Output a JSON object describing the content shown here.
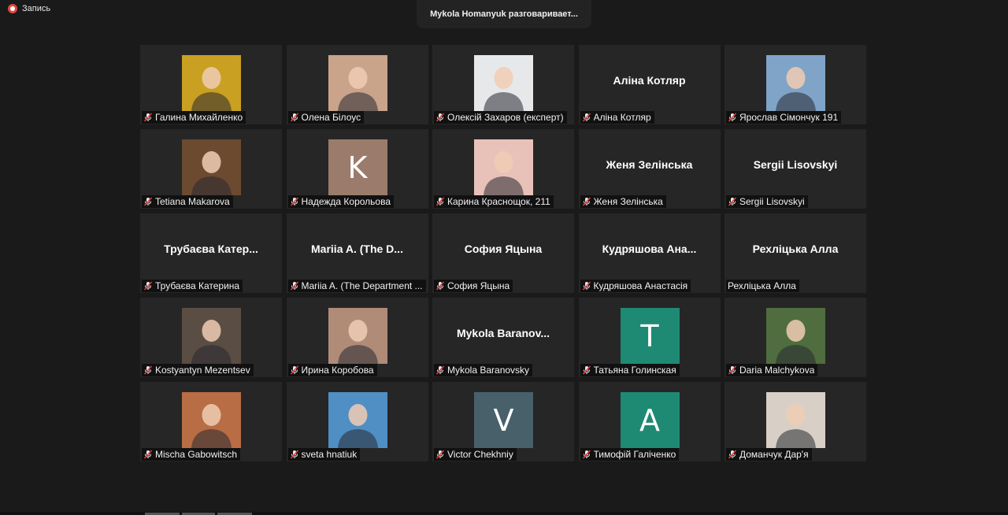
{
  "recording": {
    "label": "Запись"
  },
  "speaker": {
    "text": "Mykola Homanyuk разговаривает..."
  },
  "participants": [
    {
      "name": "Галина Михайленко",
      "muted": true,
      "type": "photo",
      "bg": "#c9a021"
    },
    {
      "name": "Олена Білоус",
      "muted": true,
      "type": "photo",
      "bg": "#c9a48a"
    },
    {
      "name": "Олексій Захаров (експерт)",
      "muted": true,
      "type": "photo",
      "bg": "#e6e8ea"
    },
    {
      "name": "Аліна Котляр",
      "muted": true,
      "type": "name",
      "display": "Аліна Котляр"
    },
    {
      "name": "Ярослав Сімончук 191",
      "muted": true,
      "type": "photo",
      "bg": "#7fa4c8"
    },
    {
      "name": "Tetiana Makarova",
      "muted": true,
      "type": "photo",
      "bg": "#6b4a2f"
    },
    {
      "name": "Надежда Корольова",
      "muted": true,
      "type": "initial",
      "display": "K",
      "bg": "#9b7b6b"
    },
    {
      "name": "Карина Краснощок, 211",
      "muted": true,
      "type": "photo",
      "bg": "#e8c2b8"
    },
    {
      "name": "Женя Зелінська",
      "muted": true,
      "type": "name",
      "display": "Женя Зелінська"
    },
    {
      "name": "Sergii Lisovskyi",
      "muted": true,
      "type": "name",
      "display": "Sergii Lisovskyi"
    },
    {
      "name": "Трубаєва Катерина",
      "muted": true,
      "type": "name",
      "display": "Трубаєва Катер..."
    },
    {
      "name": "Mariia A. (The Department ...",
      "muted": true,
      "type": "name",
      "display": "Mariia A. (The D..."
    },
    {
      "name": "София Яцына",
      "muted": true,
      "type": "name",
      "display": "София Яцына"
    },
    {
      "name": "Кудряшова Анастасія",
      "muted": true,
      "type": "name",
      "display": "Кудряшова  Ана..."
    },
    {
      "name": "Рехліцька Алла",
      "muted": false,
      "type": "name",
      "display": "Рехліцька Алла"
    },
    {
      "name": "Kostyantyn Mezentsev",
      "muted": true,
      "type": "photo",
      "bg": "#5a4d44"
    },
    {
      "name": "Ирина Коробова",
      "muted": true,
      "type": "photo",
      "bg": "#b08c78"
    },
    {
      "name": "Mykola Baranovsky",
      "muted": true,
      "type": "name",
      "display": "Mykola  Baranov..."
    },
    {
      "name": "Татьяна Голинская",
      "muted": true,
      "type": "initial",
      "display": "T",
      "bg": "#1f8a73"
    },
    {
      "name": "Daria Malchykova",
      "muted": true,
      "type": "photo",
      "bg": "#4f6d3f"
    },
    {
      "name": "Mischa Gabowitsch",
      "muted": true,
      "type": "photo",
      "bg": "#b86d44"
    },
    {
      "name": "sveta hnatiuk",
      "muted": true,
      "type": "photo",
      "bg": "#4f8fc4"
    },
    {
      "name": "Victor Chekhniy",
      "muted": true,
      "type": "initial",
      "display": "V",
      "bg": "#48606a"
    },
    {
      "name": "Тимофій Галіченко",
      "muted": true,
      "type": "initial",
      "display": "A",
      "bg": "#1f8a73"
    },
    {
      "name": "Доманчук Дар'я",
      "muted": true,
      "type": "photo",
      "bg": "#d8d0c6"
    }
  ]
}
